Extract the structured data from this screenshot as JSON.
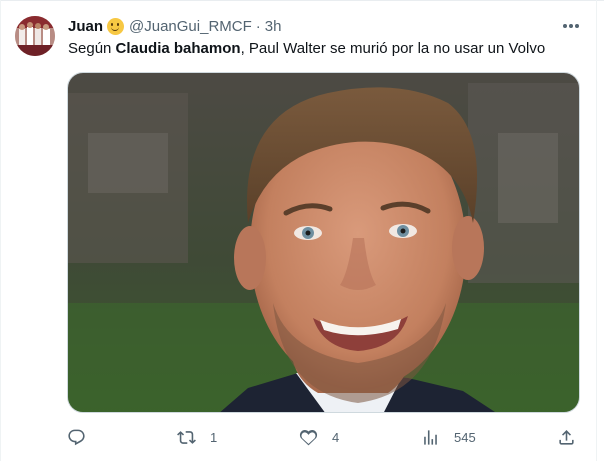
{
  "tweet": {
    "author_name": "Juan",
    "author_handle": "@JuanGui_RMCF",
    "separator": "·",
    "time_ago": "3h",
    "text_before": "Según ",
    "text_bold": "Claudia bahamon",
    "text_after": ", Paul Walter se murió por la no usar un Volvo"
  },
  "actions": {
    "reply_count": "",
    "retweet_count": "1",
    "like_count": "4",
    "views_count": "545"
  },
  "icons": {
    "avatar": "avatar-image",
    "emoji": "smiling-face-emoji",
    "more": "more-dots-icon",
    "reply": "reply-icon",
    "retweet": "retweet-icon",
    "like": "heart-icon",
    "views": "views-bar-chart-icon",
    "share": "share-icon"
  },
  "colors": {
    "text_primary": "#0f1419",
    "text_secondary": "#536471",
    "border": "#cfd9de"
  }
}
